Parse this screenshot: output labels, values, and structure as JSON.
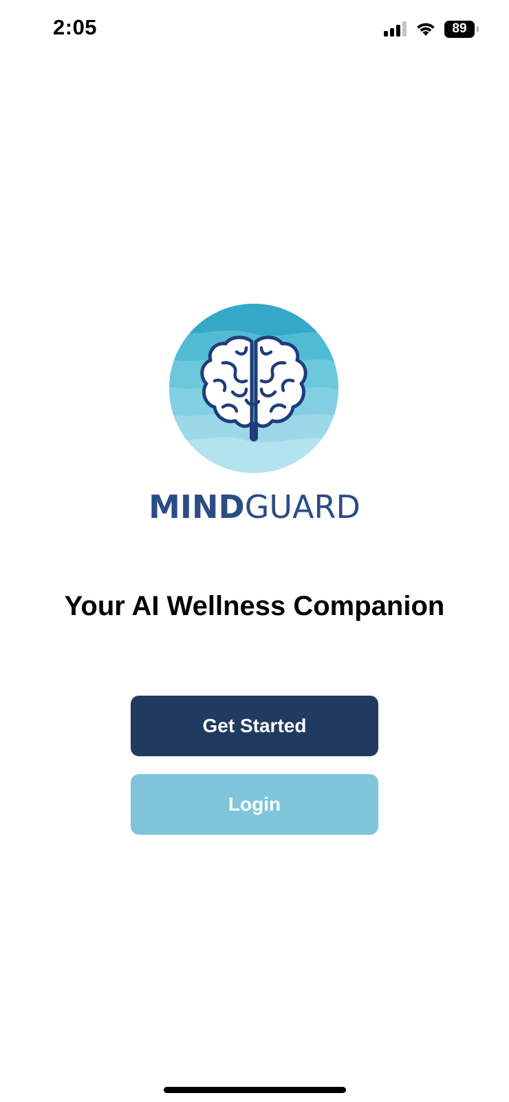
{
  "status_bar": {
    "time": "2:05",
    "battery_level": "89",
    "icons": [
      "signal-icon",
      "wifi-icon",
      "battery-icon"
    ]
  },
  "brand": {
    "name_bold": "MIND",
    "name_regular": "GUARD",
    "logo_icon": "brain-icon",
    "color": "#2b4c86"
  },
  "tagline": "Your AI Wellness Companion",
  "buttons": {
    "get_started": "Get Started",
    "login": "Login"
  },
  "colors": {
    "primary_button": "#213a60",
    "secondary_button": "#7fc5da",
    "logo_background": "#5fc3d8"
  }
}
